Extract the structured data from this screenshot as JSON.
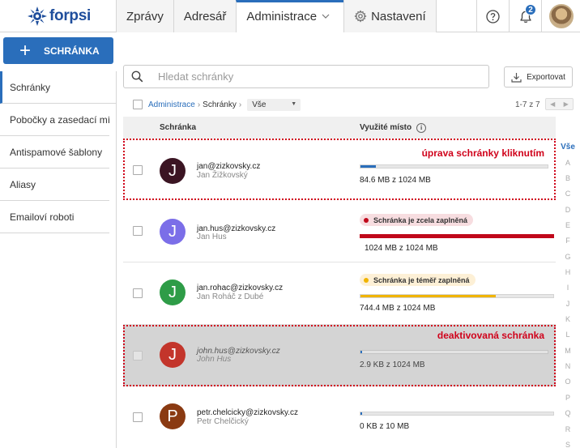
{
  "topbar": {
    "logo_text": "forpsi",
    "tabs": [
      {
        "label": "Zprávy"
      },
      {
        "label": "Adresář"
      },
      {
        "label": "Administrace"
      },
      {
        "label": "Nastavení"
      }
    ],
    "notification_count": "2"
  },
  "sidebar": {
    "new_button_label": "SCHRÁNKA",
    "items": [
      {
        "label": "Schránky"
      },
      {
        "label": "Pobočky a zasedací mís..."
      },
      {
        "label": "Antispamové šablony"
      },
      {
        "label": "Aliasy"
      },
      {
        "label": "Emailoví roboti"
      }
    ]
  },
  "toolbar": {
    "search_placeholder": "Hledat schránky",
    "export_label": "Exportovat"
  },
  "breadcrumb": {
    "root": "Administrace",
    "current": "Schránky",
    "filter_value": "Vše",
    "pager_text": "1-7 z 7"
  },
  "table": {
    "headers": {
      "mailbox": "Schránka",
      "usage": "Využité místo"
    },
    "rows": [
      {
        "initial": "J",
        "email": "jan@zizkovsky.cz",
        "name": "Jan Žižkovský",
        "usage": "84.6 MB z 1024 MB",
        "annotation": "úprava schránky kliknutím"
      },
      {
        "initial": "J",
        "email": "jan.hus@zizkovsky.cz",
        "name": "Jan Hus",
        "usage": "1024 MB z 1024 MB",
        "status": "Schránka je zcela zaplněná"
      },
      {
        "initial": "J",
        "email": "jan.rohac@zizkovsky.cz",
        "name": "Jan Roháč z Dubé",
        "usage": "744.4 MB z 1024 MB",
        "status": "Schránka je téměř zaplněná"
      },
      {
        "initial": "J",
        "email": "john.hus@zizkovsky.cz",
        "name": "John Hus",
        "usage": "2.9 KB z 1024 MB",
        "annotation": "deaktivovaná schránka"
      },
      {
        "initial": "P",
        "email": "petr.chelcicky@zizkovsky.cz",
        "name": "Petr Chelčický",
        "usage": "0 KB z 10 MB"
      }
    ]
  },
  "letters": [
    "Vše",
    "A",
    "B",
    "C",
    "D",
    "E",
    "F",
    "G",
    "H",
    "I",
    "J",
    "K",
    "L",
    "M",
    "N",
    "O",
    "P",
    "Q",
    "R",
    "S"
  ],
  "colors": {
    "accent": "#2a6ebb",
    "annotation": "#d0021b",
    "bar_full": "#c0081a",
    "bar_warning": "#f0b400",
    "pill_full_bg": "#f7dde0",
    "pill_warning_bg": "#fdf0d6"
  }
}
